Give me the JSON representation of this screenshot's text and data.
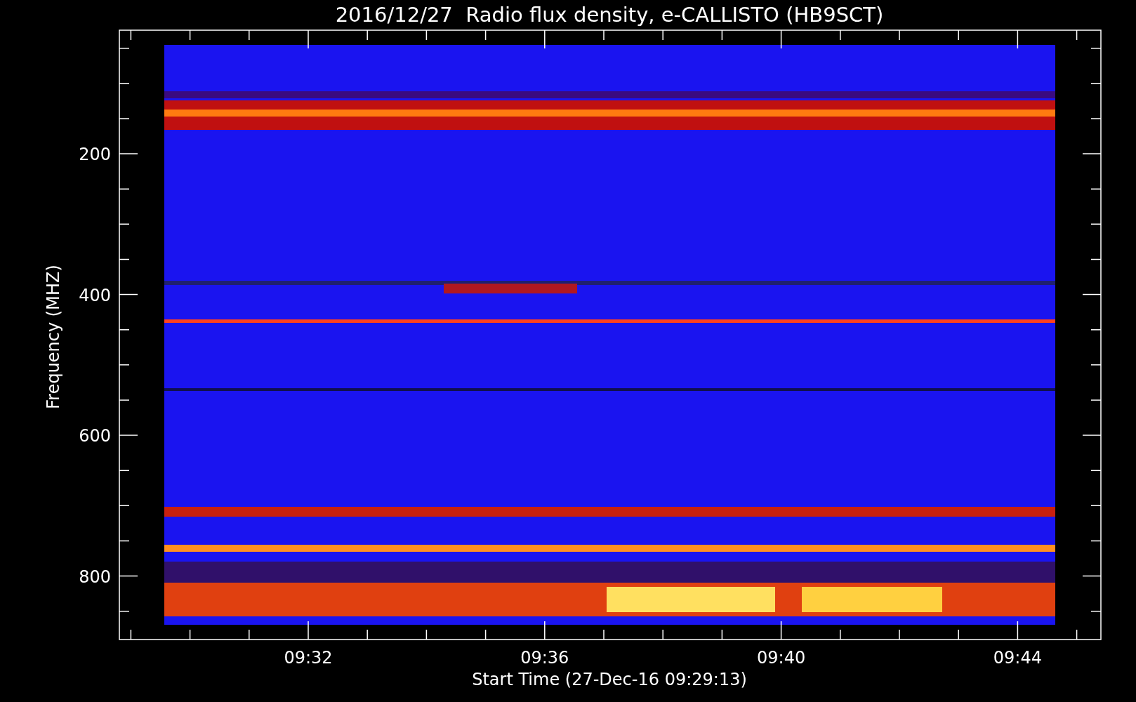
{
  "title": "2016/12/27  Radio flux density, e-CALLISTO (HB9SCT)",
  "y_axis": {
    "label": "Frequency (MHZ)",
    "tick_labels": [
      "200",
      "400",
      "600",
      "800"
    ]
  },
  "x_axis": {
    "label": "Start Time (27-Dec-16 09:29:13)",
    "tick_labels": [
      "09:32",
      "09:36",
      "09:40",
      "09:44"
    ]
  }
}
